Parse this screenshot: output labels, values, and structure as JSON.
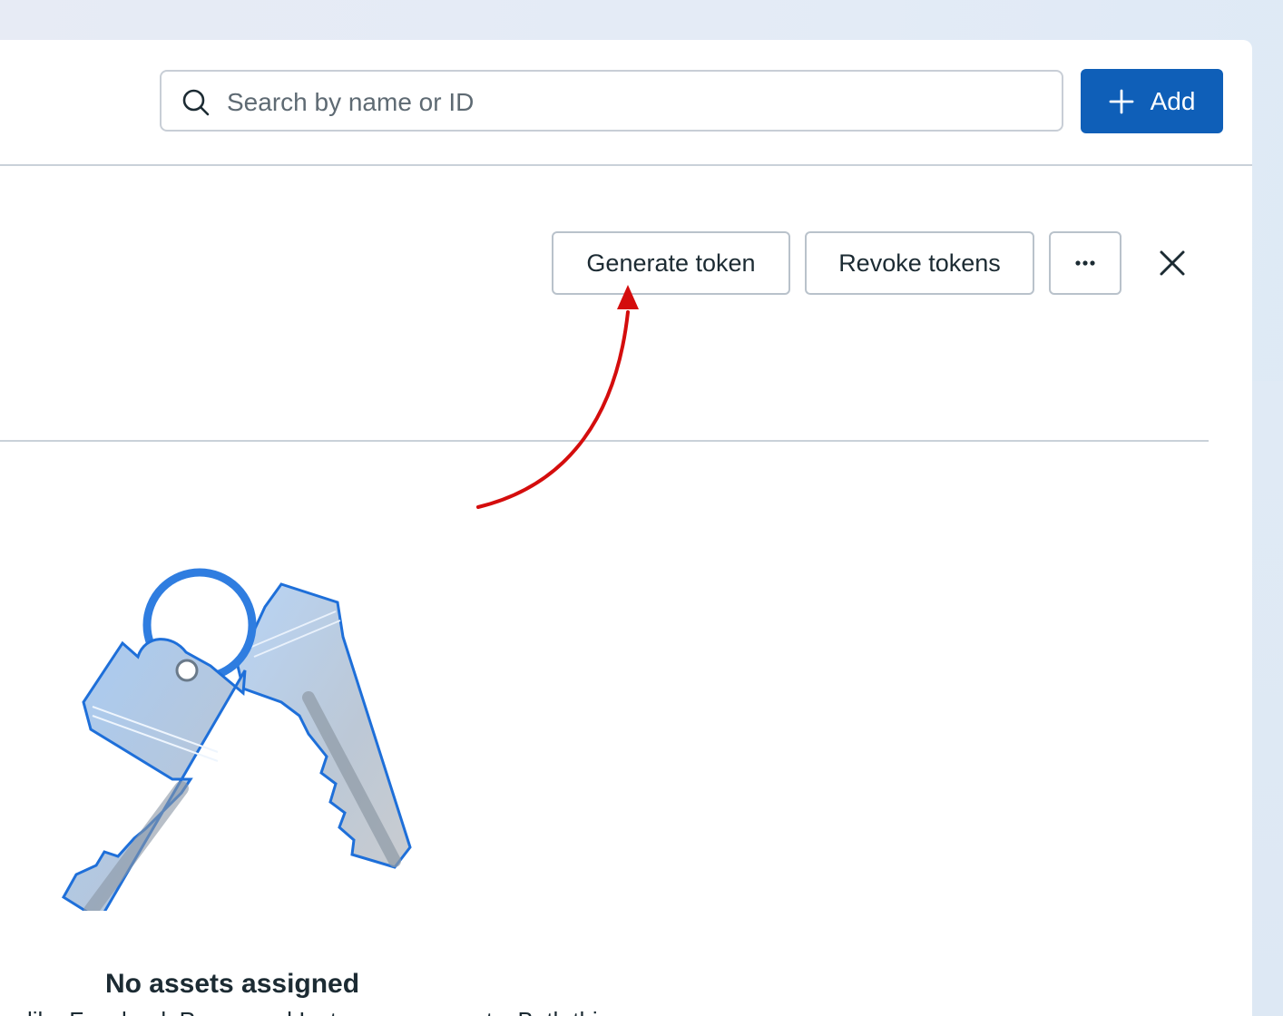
{
  "search": {
    "placeholder": "Search by name or ID"
  },
  "toolbar": {
    "add_label": "Add"
  },
  "detail_actions": {
    "generate_token_label": "Generate token",
    "revoke_tokens_label": "Revoke tokens",
    "more_icon": "more-horizontal-icon",
    "close_icon": "close-icon"
  },
  "empty_state": {
    "illustration": "keys-illustration",
    "title": "No assets assigned",
    "description_partial": "like Facebook Pages and Instagram accounts. Both this"
  },
  "annotation": {
    "color": "#d40d0d"
  },
  "colors": {
    "primary": "#0f5fb8",
    "text": "#1c2b33",
    "border": "#c9d1d9"
  }
}
